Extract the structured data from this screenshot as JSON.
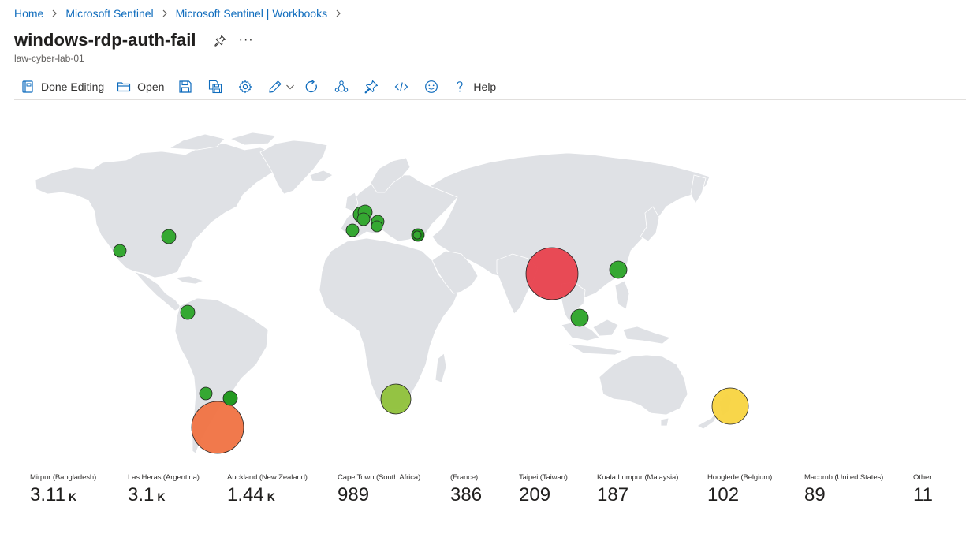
{
  "breadcrumb": [
    {
      "label": "Home"
    },
    {
      "label": "Microsoft Sentinel"
    },
    {
      "label": "Microsoft Sentinel | Workbooks"
    }
  ],
  "page": {
    "title": "windows-rdp-auth-fail",
    "subtitle": "law-cyber-lab-01",
    "more_label": "···"
  },
  "toolbar": {
    "done_editing": "Done Editing",
    "open": "Open",
    "help": "Help",
    "icons": [
      "done-editing-icon",
      "open-folder-icon",
      "save-icon",
      "save-as-icon",
      "settings-gear-icon",
      "edit-pencil-icon",
      "chevron-down-icon",
      "refresh-icon",
      "share-icon",
      "pin-icon",
      "code-icon",
      "feedback-smiley-icon",
      "help-question-icon"
    ]
  },
  "map": {
    "land_color": "#dfe1e5",
    "locations": [
      {
        "name": "Mirpur (Bangladesh)",
        "color": "#e8414d"
      },
      {
        "name": "Las Heras (Argentina)",
        "color": "#f07242"
      },
      {
        "name": "Auckland (New Zealand)",
        "color": "#f8d440"
      },
      {
        "name": "Cape Town (South Africa)",
        "color": "#8fc13a"
      },
      {
        "name": "Taipei (Taiwan)",
        "color": "#35a832"
      },
      {
        "name": "Kuala Lumpur (Malaysia)",
        "color": "#35a832"
      },
      {
        "name": "United States",
        "color": "#35a832"
      },
      {
        "name": "Colombia",
        "color": "#35a832"
      },
      {
        "name": "Europe",
        "color": "#35a832"
      }
    ]
  },
  "tiles": [
    {
      "location": "Mirpur (Bangladesh)",
      "value": "3.11",
      "unit": "K"
    },
    {
      "location": "Las Heras (Argentina)",
      "value": "3.1",
      "unit": "K"
    },
    {
      "location": "Auckland (New Zealand)",
      "value": "1.44",
      "unit": "K"
    },
    {
      "location": "Cape Town (South Africa)",
      "value": "989",
      "unit": ""
    },
    {
      "location": "(France)",
      "value": "386",
      "unit": ""
    },
    {
      "location": "Taipei (Taiwan)",
      "value": "209",
      "unit": ""
    },
    {
      "location": "Kuala Lumpur (Malaysia)",
      "value": "187",
      "unit": ""
    },
    {
      "location": "Hooglede (Belgium)",
      "value": "102",
      "unit": ""
    },
    {
      "location": "Macomb (United States)",
      "value": "89",
      "unit": ""
    },
    {
      "location": "Other",
      "value": "11",
      "unit": ""
    }
  ]
}
